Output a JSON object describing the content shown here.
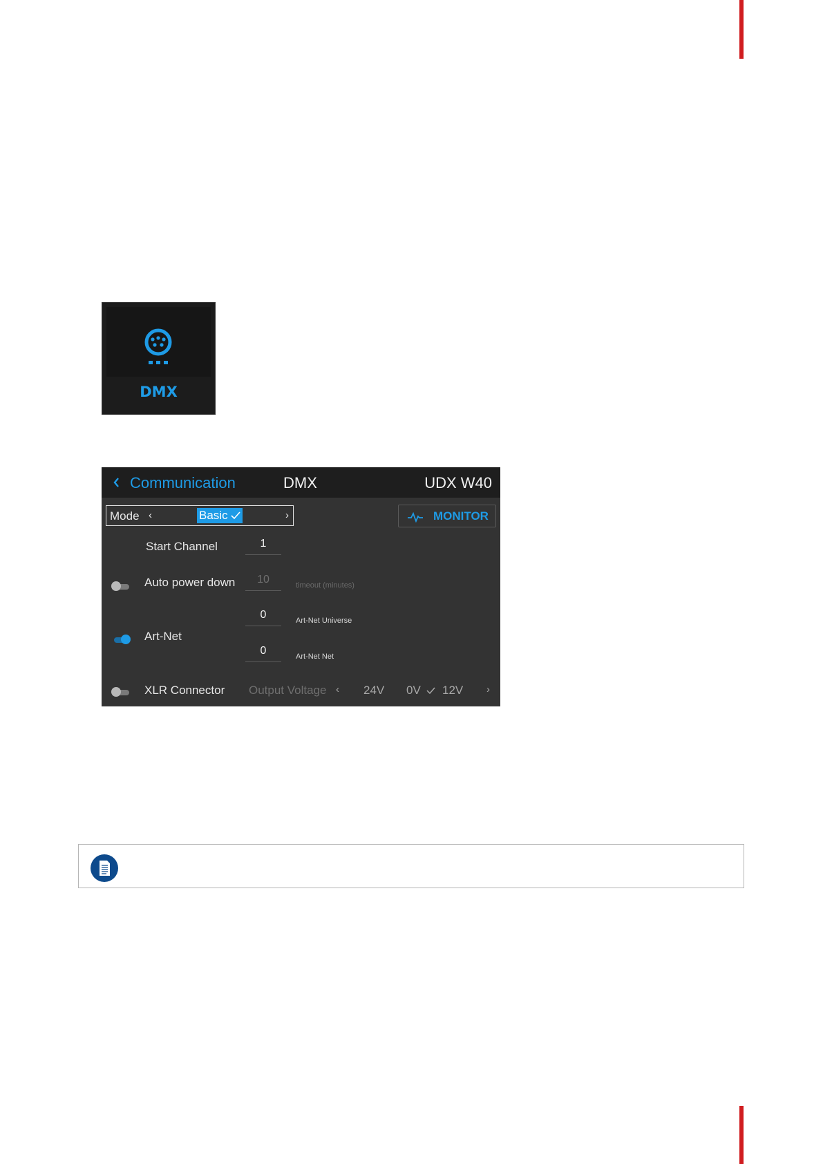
{
  "tile": {
    "icon": "dmx-connector-icon",
    "label": "DMX",
    "accent_color": "#1e9be6"
  },
  "menu": {
    "header": {
      "back_label": "Communication",
      "title": "DMX",
      "device": "UDX W40"
    },
    "mode": {
      "label": "Mode",
      "value": "Basic",
      "prev_glyph": "‹",
      "next_glyph": "›"
    },
    "monitor_button": {
      "label": "MONITOR",
      "icon": "pulse-icon"
    },
    "start_channel": {
      "label": "Start Channel",
      "value": "1"
    },
    "auto_power_down": {
      "label": "Auto power down",
      "enabled": false,
      "value": "10",
      "hint": "timeout (minutes)"
    },
    "art_net": {
      "label": "Art-Net",
      "enabled": true,
      "universe_value": "0",
      "universe_hint": "Art-Net Universe",
      "net_value": "0",
      "net_hint": "Art-Net Net"
    },
    "xlr": {
      "label": "XLR Connector",
      "enabled": false,
      "output_label": "Output Voltage",
      "options": [
        "24V",
        "0V",
        "12V"
      ],
      "selected": "0V"
    }
  },
  "note": {
    "icon": "note-document-icon"
  },
  "colors": {
    "brand_red": "#d01c1f",
    "accent_blue": "#1e9be6",
    "panel_bg": "#333333",
    "header_bg": "#1e1e1e"
  }
}
